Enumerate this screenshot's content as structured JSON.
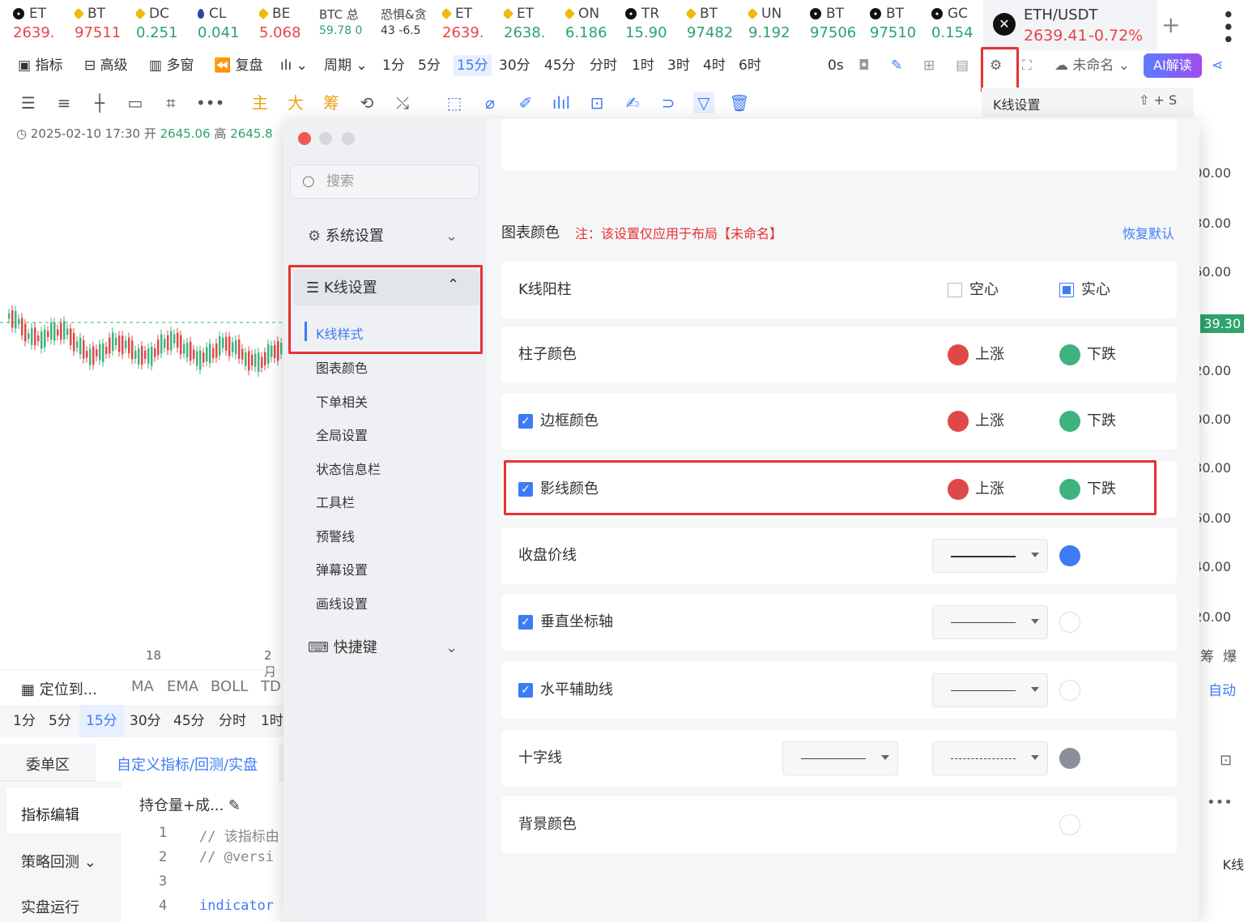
{
  "tickers": [
    {
      "sym": "ET",
      "price": "2639.",
      "cls": "red",
      "icon": "okx"
    },
    {
      "sym": "BT",
      "price": "97511",
      "cls": "red",
      "icon": "bn"
    },
    {
      "sym": "DC",
      "price": "0.251",
      "cls": "grn",
      "icon": "bn"
    },
    {
      "sym": "CL",
      "price": "0.041",
      "cls": "grn",
      "icon": "drop"
    },
    {
      "sym": "BE",
      "price": "5.068",
      "cls": "red",
      "icon": "bn"
    },
    {
      "sym": "BTC 总",
      "price": "59.78 0",
      "cls": "grn",
      "icon": ""
    },
    {
      "sym": "恐惧&贪",
      "price": "43 -6.5",
      "cls": "",
      "icon": ""
    },
    {
      "sym": "ET",
      "price": "2639.",
      "cls": "red",
      "icon": "bn"
    },
    {
      "sym": "ET",
      "price": "2638.",
      "cls": "grn",
      "icon": "bn"
    },
    {
      "sym": "ON",
      "price": "6.186",
      "cls": "grn",
      "icon": "bn"
    },
    {
      "sym": "TR",
      "price": "15.90",
      "cls": "grn",
      "icon": "okx"
    },
    {
      "sym": "BT",
      "price": "97482",
      "cls": "grn",
      "icon": "bn"
    },
    {
      "sym": "UN",
      "price": "9.192",
      "cls": "grn",
      "icon": "bn"
    },
    {
      "sym": "BT",
      "price": "97506",
      "cls": "grn",
      "icon": "okx"
    },
    {
      "sym": "BT",
      "price": "97510",
      "cls": "grn",
      "icon": "okx"
    },
    {
      "sym": "GC",
      "price": "0.154",
      "cls": "grn",
      "icon": "okx"
    }
  ],
  "active_tab": {
    "pair": "ETH/USDT",
    "price": "2639.41",
    "change": "-0.72%"
  },
  "toolbar": {
    "indicator": "指标",
    "advanced": "高级",
    "multi": "多窗",
    "replay": "复盘",
    "period": "周期",
    "periods": [
      "1分",
      "5分",
      "15分",
      "30分",
      "45分",
      "分时",
      "1时",
      "3时",
      "4时",
      "6时"
    ],
    "zero_s": "0s",
    "layout": "未命名",
    "ai": "AI解读"
  },
  "drawing_tools": {
    "main": "主",
    "big": "大",
    "chip": "筹"
  },
  "chart": {
    "date": "2025-02-10 17:30",
    "open_label": "开",
    "open": "2645.06",
    "high_label": "高",
    "high": "2645.8",
    "x_ticks": [
      "18",
      "2月"
    ]
  },
  "right_axis": [
    "00.00",
    "30.00",
    "60.00",
    "39.30",
    "20.00",
    "00.00",
    "30.00",
    "60.00",
    "40.00",
    "20.00"
  ],
  "right_panel": {
    "title": "K线设置",
    "chip": "筹",
    "burst": "爆",
    "auto": "自动",
    "kline": "K线"
  },
  "bottom": {
    "locate": "定位到...",
    "indicators": [
      "MA",
      "EMA",
      "BOLL",
      "TD"
    ],
    "periods": [
      "1分",
      "5分",
      "15分",
      "30分",
      "45分",
      "分时",
      "1时"
    ],
    "tabs": [
      "委单区",
      "自定义指标/回测/实盘"
    ],
    "side": [
      "指标编辑",
      "策略回测",
      "实盘运行"
    ],
    "file": "持仓量+成...",
    "code": [
      {
        "n": "1",
        "t": "// 该指标由"
      },
      {
        "n": "2",
        "t": "// @versi"
      },
      {
        "n": "3",
        "t": ""
      },
      {
        "n": "4",
        "t": "indicator"
      }
    ]
  },
  "sidebar": {
    "search_placeholder": "搜索",
    "system": "系统设置",
    "kline": "K线设置",
    "kline_style": "K线样式",
    "items": [
      "图表颜色",
      "下单相关",
      "全局设置",
      "状态信息栏",
      "工具栏",
      "预警线",
      "弹幕设置",
      "画线设置"
    ],
    "shortcut": "快捷键"
  },
  "settings": {
    "section_title": "图表颜色",
    "note": "注：该设置仅应用于布局【未命名】",
    "restore": "恢复默认",
    "rows": {
      "kline_yang": {
        "label": "K线阳柱",
        "opt1": "空心",
        "opt2": "实心"
      },
      "bar_color": {
        "label": "柱子颜色",
        "up": "上涨",
        "down": "下跌"
      },
      "border_color": {
        "label": "边框颜色",
        "up": "上涨",
        "down": "下跌"
      },
      "shadow_color": {
        "label": "影线颜色",
        "up": "上涨",
        "down": "下跌"
      },
      "close_line": {
        "label": "收盘价线"
      },
      "vertical_axis": {
        "label": "垂直坐标轴"
      },
      "horizontal_grid": {
        "label": "水平辅助线"
      },
      "crosshair": {
        "label": "十字线"
      },
      "background": {
        "label": "背景颜色"
      }
    }
  },
  "colors": {
    "up": "#e04848",
    "down": "#3fb37f",
    "accent": "#3d7cf5",
    "highlight": "#e63232"
  }
}
